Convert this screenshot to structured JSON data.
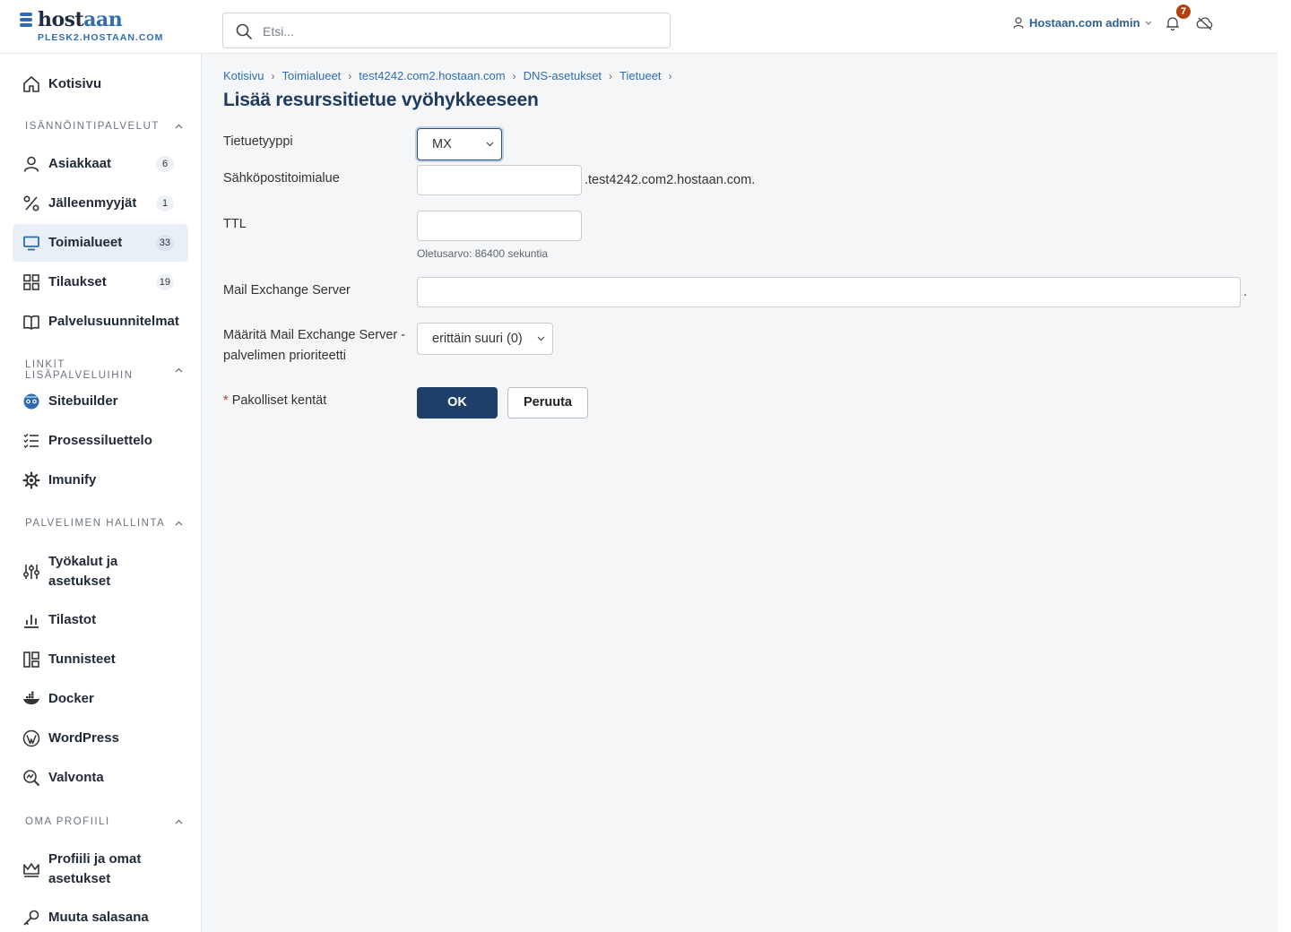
{
  "brand": {
    "name_part1": "host",
    "name_part2": "aan",
    "server": "PLESK2.HOSTAAN.COM"
  },
  "search": {
    "placeholder": "Etsi..."
  },
  "user": {
    "name": "Hostaan.com admin"
  },
  "notifications": {
    "count": "7"
  },
  "sidebar": {
    "home": "Kotisivu",
    "sections": [
      {
        "title": "ISÄNNÖINTIPALVELUT"
      },
      {
        "title": "LINKIT LISÄPALVELUIHIN"
      },
      {
        "title": "PALVELIMEN HALLINTA"
      },
      {
        "title": "OMA PROFIILI"
      }
    ],
    "items": [
      {
        "label": "Asiakkaat",
        "count": "6"
      },
      {
        "label": "Jälleenmyyjät",
        "count": "1"
      },
      {
        "label": "Toimialueet",
        "count": "33"
      },
      {
        "label": "Tilaukset",
        "count": "19"
      },
      {
        "label": "Palvelusuunnitelmat"
      },
      {
        "label": "Sitebuilder"
      },
      {
        "label": "Prosessiluettelo"
      },
      {
        "label": "Imunify"
      },
      {
        "label": "Työkalut ja asetukset"
      },
      {
        "label": "Tilastot"
      },
      {
        "label": "Tunnisteet"
      },
      {
        "label": "Docker"
      },
      {
        "label": "WordPress"
      },
      {
        "label": "Valvonta"
      },
      {
        "label": "Profiili ja omat asetukset"
      },
      {
        "label": "Muuta salasana"
      }
    ]
  },
  "breadcrumb": [
    "Kotisivu",
    "Toimialueet",
    "test4242.com2.hostaan.com",
    "DNS-asetukset",
    "Tietueet"
  ],
  "page": {
    "title": "Lisää resurssitietue vyöhykkeeseen"
  },
  "form": {
    "record_type": {
      "label": "Tietuetyyppi",
      "value": "MX"
    },
    "mail_domain": {
      "label": "Sähköpostitoimialue",
      "value": "",
      "suffix": ".test4242.com2.hostaan.com."
    },
    "ttl": {
      "label": "TTL",
      "value": "",
      "hint": "Oletusarvo: 86400 sekuntia"
    },
    "mx_server": {
      "label": "Mail Exchange Server",
      "value": "",
      "suffix": "."
    },
    "priority": {
      "label_line1": "Määritä Mail Exchange Server -",
      "label_line2": "palvelimen prioriteetti",
      "value": "erittäin suuri (0)"
    },
    "required": {
      "star": "*",
      "label": "Pakolliset kentät"
    },
    "ok_label": "OK",
    "cancel_label": "Peruuta"
  },
  "colors": {
    "accent": "#1f3f6b",
    "link": "#2f6db0",
    "badge": "#b3400f"
  }
}
